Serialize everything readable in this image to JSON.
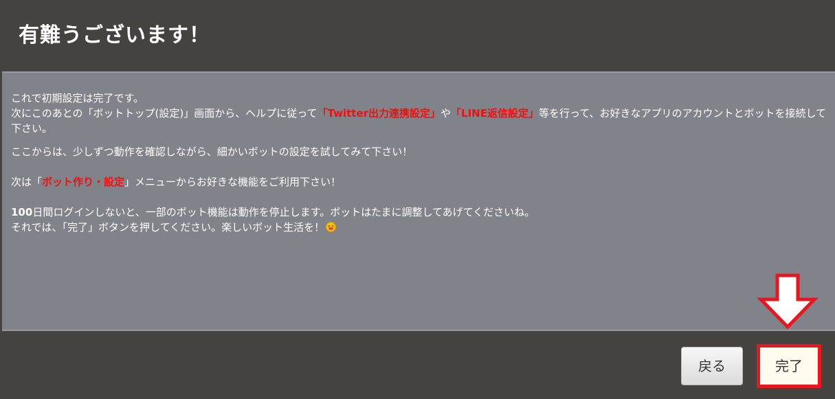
{
  "dialog": {
    "title": "有難うございます！",
    "body": {
      "line1": "これで初期設定は完了です。",
      "line2_a": "次にこのあとの「ボットトップ(設定)」画面から、ヘルプに従って",
      "line2_hl1": "「Twitter出力連携設定」",
      "line2_b": "や",
      "line2_hl2": "「LINE返信設定」",
      "line2_c": "等を行って、お好きなアプリのアカウントとボットを接続して下さい。",
      "line3": "ここからは、少しずつ動作を確認しながら、細かいボットの設定を試してみて下さい！",
      "line4_a": "次は「",
      "line4_hl": "ボット作り・設定",
      "line4_b": "」メニューからお好きな機能をご利用下さい！",
      "line5_num": "100",
      "line5_rest": "日間ログインしないと、一部のボット機能は動作を停止します。ボットはたまに調整してあげてくださいね。",
      "line6": "それでは、「完了」ボタンを押してください。楽しいボット生活を！"
    },
    "buttons": {
      "back_label": "戻る",
      "done_label": "完了"
    },
    "icons": {
      "smile": "smiley-emoji-icon",
      "arrow": "down-arrow-icon"
    },
    "colors": {
      "header_bg": "#454340",
      "body_bg": "#808389",
      "highlight": "#ee1111",
      "annotation_red": "#e8171f"
    }
  }
}
